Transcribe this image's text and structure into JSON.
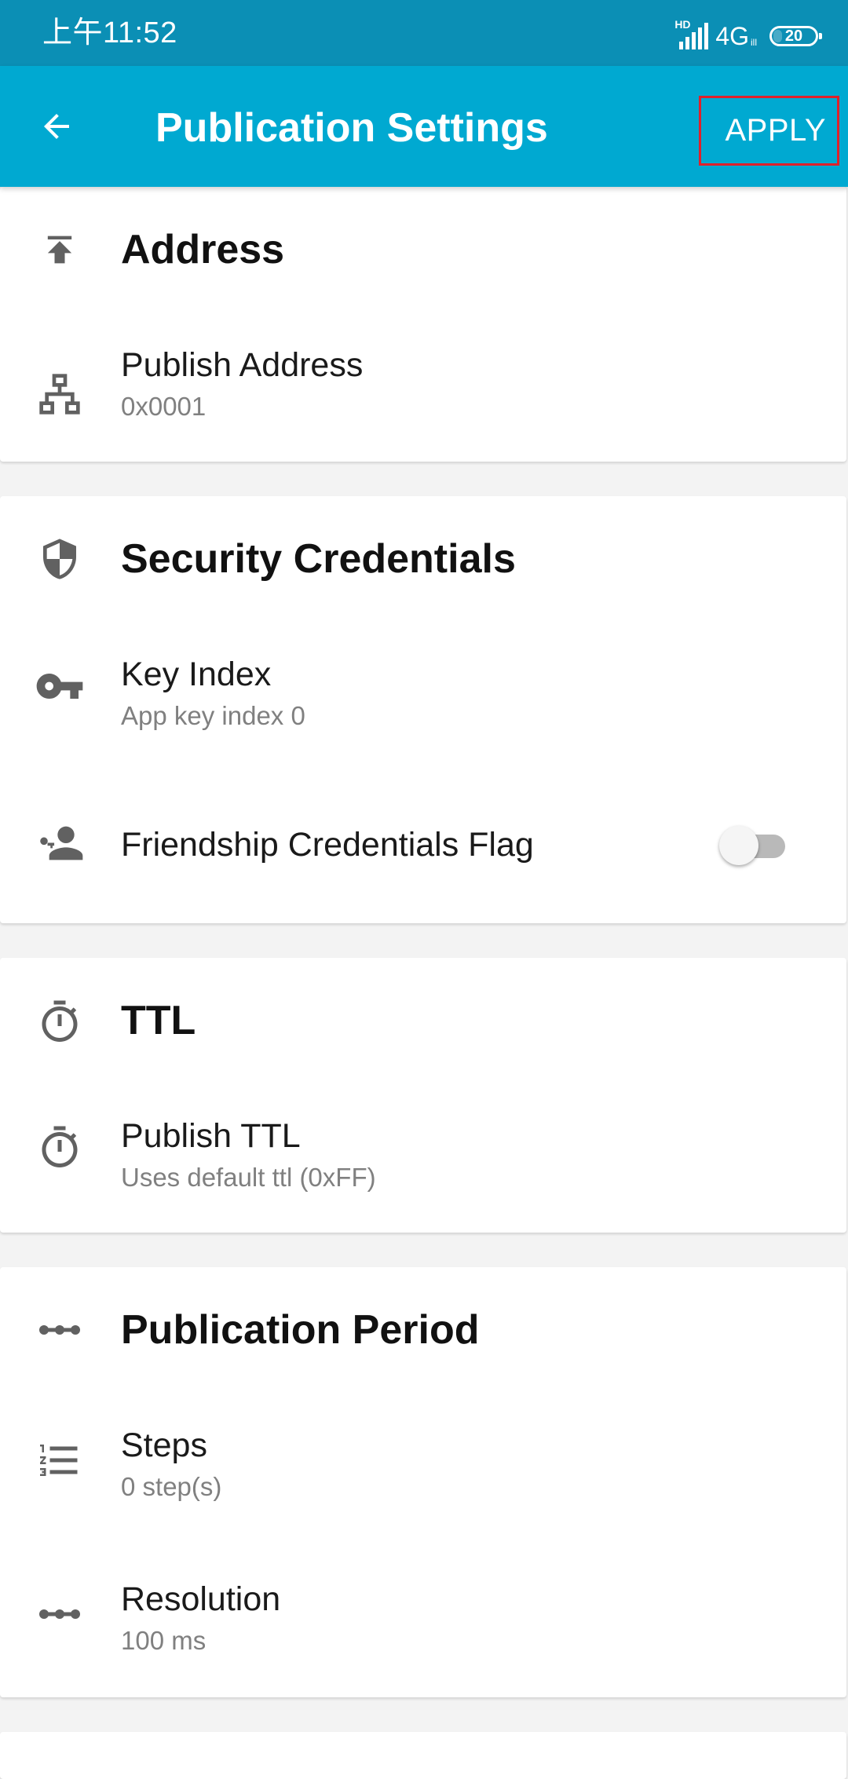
{
  "status_bar": {
    "time": "上午11:52",
    "hd_label": "HD",
    "network": "4G",
    "network_sub": "ill",
    "battery": "20"
  },
  "app_bar": {
    "title": "Publication Settings",
    "apply_label": "APPLY",
    "back_icon": "arrow-left-icon"
  },
  "sections": {
    "address": {
      "title": "Address",
      "icon": "publish-upload-icon",
      "publish_address": {
        "label": "Publish Address",
        "value": "0x0001",
        "icon": "network-tree-icon"
      }
    },
    "security": {
      "title": "Security Credentials",
      "icon": "shield-icon",
      "key_index": {
        "label": "Key Index",
        "value": "App key index 0",
        "icon": "key-icon"
      },
      "friendship_flag": {
        "label": "Friendship Credentials Flag",
        "icon": "key-person-icon",
        "enabled": false
      }
    },
    "ttl": {
      "title": "TTL",
      "icon": "timer-icon",
      "publish_ttl": {
        "label": "Publish TTL",
        "value": "Uses default ttl (0xFF)",
        "icon": "timer-icon"
      }
    },
    "period": {
      "title": "Publication Period",
      "icon": "dots-line-icon",
      "steps": {
        "label": "Steps",
        "value": "0 step(s)",
        "icon": "numbered-list-icon"
      },
      "resolution": {
        "label": "Resolution",
        "value": "100 ms",
        "icon": "dots-line-icon"
      }
    }
  },
  "colors": {
    "status_bar": "#0b8fb5",
    "app_bar": "#00a9d1",
    "apply_highlight": "#e0202a",
    "icon": "#616161",
    "background": "#f3f3f3"
  }
}
